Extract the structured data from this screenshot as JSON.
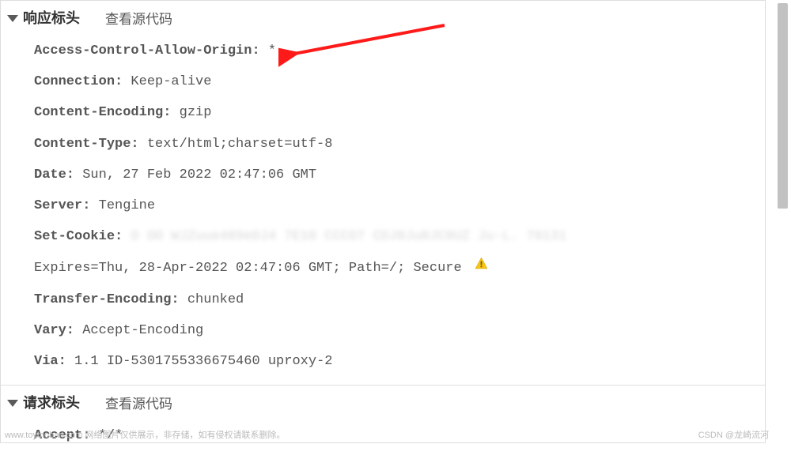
{
  "responseSection": {
    "title": "响应标头",
    "viewSource": "查看源代码",
    "headers": [
      {
        "name": "Access-Control-Allow-Origin:",
        "value": " *"
      },
      {
        "name": "Connection:",
        "value": " Keep-alive"
      },
      {
        "name": "Content-Encoding:",
        "value": " gzip"
      },
      {
        "name": "Content-Type:",
        "value": " text/html;charset=utf-8"
      },
      {
        "name": "Date:",
        "value": " Sun, 27 Feb 2022 02:47:06 GMT"
      },
      {
        "name": "Server:",
        "value": " Tengine"
      }
    ],
    "setCookieName": "Set-Cookie:",
    "setCookieRedacted": "O OO  WJZuue489eDJ4  7E10 CCCO7    CDJ0Ju0JC0UZ       Ju-L.     70131",
    "setCookieLine2": "Expires=Thu, 28-Apr-2022 02:47:06 GMT; Path=/; Secure",
    "tailHeaders": [
      {
        "name": "Transfer-Encoding:",
        "value": " chunked"
      },
      {
        "name": "Vary:",
        "value": " Accept-Encoding"
      },
      {
        "name": "Via:",
        "value": " 1.1 ID-5301755336675460 uproxy-2"
      }
    ]
  },
  "requestSection": {
    "title": "请求标头",
    "viewSource": "查看源代码",
    "headers": [
      {
        "name": "Accept:",
        "value": " */*"
      }
    ]
  },
  "watermark": {
    "left": "www.toymoban.com 网络图片仅供展示，非存储，如有侵权请联系删除。",
    "right": "CSDN @龙崎流河"
  }
}
